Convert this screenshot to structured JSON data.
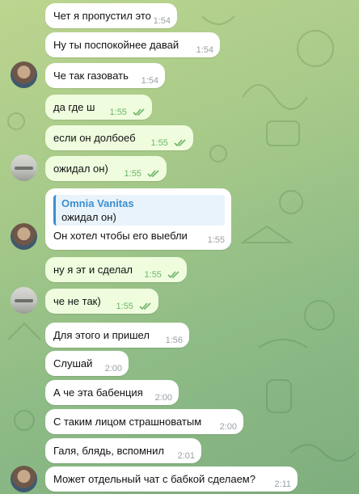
{
  "colors": {
    "incoming_bubble": "#ffffff",
    "outgoing_bubble": "#effdde",
    "read_check": "#6db56a",
    "reply_accent": "#3a8fd1"
  },
  "messages": [
    {
      "text": "Чет я пропустил это",
      "time": "1:54",
      "dir": "in"
    },
    {
      "text": "Ну ты поспокойнее давай",
      "time": "1:54",
      "dir": "in"
    },
    {
      "text": "Че так газовать",
      "time": "1:54",
      "dir": "in",
      "avatar": "man"
    },
    {
      "text": "да где ш",
      "time": "1:55",
      "dir": "out",
      "status": "read"
    },
    {
      "text": "если он долбоеб",
      "time": "1:55",
      "dir": "out",
      "status": "read"
    },
    {
      "text": "ожидал он)",
      "time": "1:55",
      "dir": "out",
      "status": "read",
      "avatar": "car"
    },
    {
      "text": "Он хотел чтобы его выебли",
      "time": "1:55",
      "dir": "in",
      "avatar": "man",
      "reply": {
        "name": "Omnia Vanitas",
        "text": "ожидал он)"
      }
    },
    {
      "text": "ну я эт и сделал",
      "time": "1:55",
      "dir": "out",
      "status": "read"
    },
    {
      "text": "че не так)",
      "time": "1:55",
      "dir": "out",
      "status": "read",
      "avatar": "car"
    },
    {
      "text": "Для этого и пришел",
      "time": "1:56",
      "dir": "in"
    },
    {
      "text": "Слушай",
      "time": "2:00",
      "dir": "in"
    },
    {
      "text": "А че эта бабенция",
      "time": "2:00",
      "dir": "in"
    },
    {
      "text": "С таким лицом страшноватым",
      "time": "2:00",
      "dir": "in"
    },
    {
      "text": "Галя, блядь, вспомнил",
      "time": "2:01",
      "dir": "in"
    },
    {
      "text": "Может отдельный чат с бабкой сделаем?",
      "time": "2:11",
      "dir": "in",
      "avatar": "man"
    }
  ]
}
